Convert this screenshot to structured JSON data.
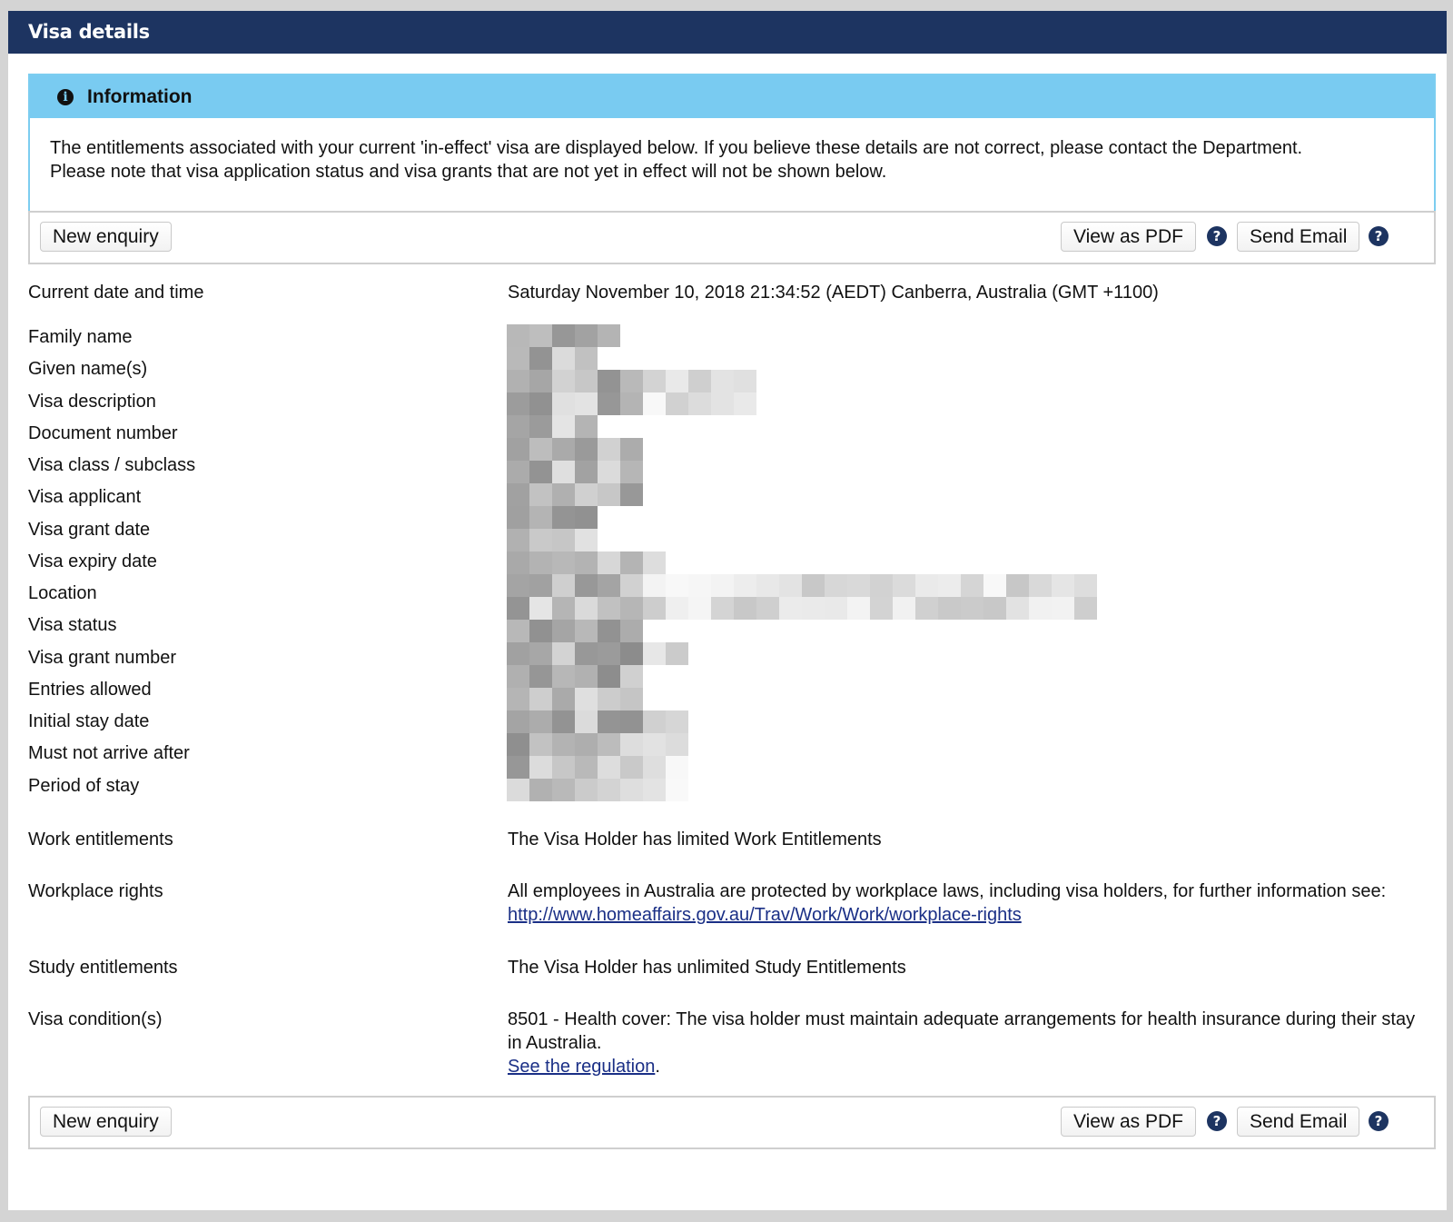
{
  "header": {
    "title": "Visa details"
  },
  "info": {
    "title": "Information",
    "line1": "The entitlements associated with your current 'in-effect' visa are displayed below. If you believe these details are not correct, please contact the Department.",
    "line2": "Please note that visa application status and visa grants that are not yet in effect will not be shown below."
  },
  "actions": {
    "new_enquiry": "New enquiry",
    "view_pdf": "View as PDF",
    "send_email": "Send Email",
    "help_glyph": "?"
  },
  "fields": {
    "current_date_label": "Current date and time",
    "current_date_value": "Saturday November 10, 2018 21:34:52 (AEDT) Canberra, Australia (GMT +1100)",
    "family_name": "Family name",
    "given_names": "Given name(s)",
    "visa_description": "Visa description",
    "document_number": "Document number",
    "visa_class": "Visa class / subclass",
    "visa_applicant": "Visa applicant",
    "visa_grant_date": "Visa grant date",
    "visa_expiry_date": "Visa expiry date",
    "location": "Location",
    "visa_status": "Visa status",
    "visa_grant_number": "Visa grant number",
    "entries_allowed": "Entries allowed",
    "initial_stay_date": "Initial stay date",
    "must_not_arrive_after": "Must not arrive after",
    "period_of_stay": "Period of stay",
    "work_label": "Work entitlements",
    "work_value": "The Visa Holder has limited Work Entitlements",
    "workplace_label": "Workplace rights",
    "workplace_value": "All employees in Australia are protected by workplace laws, including visa holders, for further information see:",
    "workplace_link": "http://www.homeaffairs.gov.au/Trav/Work/Work/workplace-rights",
    "study_label": "Study entitlements",
    "study_value": "The Visa Holder has unlimited Study Entitlements",
    "conditions_label": "Visa condition(s)",
    "conditions_value": "8501 - Health cover: The visa holder must maintain adequate arrangements for health insurance during their stay in Australia.",
    "conditions_link": "See the regulation",
    "conditions_link_suffix": "."
  },
  "colors": {
    "header_bg": "#1d3461",
    "info_bg": "#79cbf1",
    "link": "#1a2f86"
  },
  "icons": {
    "info": "info-circle-icon",
    "help": "help-circle-icon"
  }
}
